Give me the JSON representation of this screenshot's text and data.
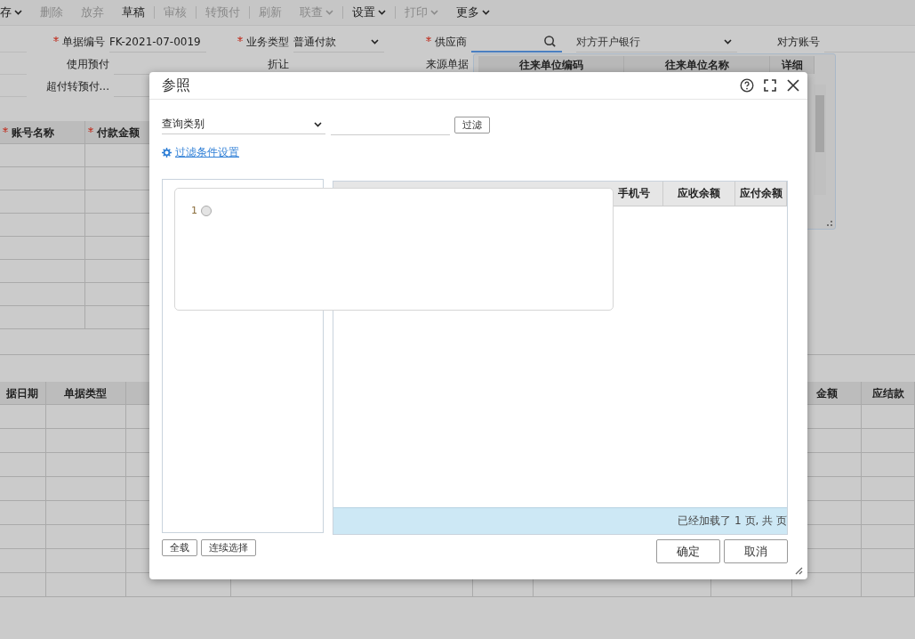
{
  "toolbar": [
    {
      "label": "存",
      "dropdown": true,
      "disabled": false,
      "separator": false
    },
    {
      "label": "删除",
      "dropdown": false,
      "disabled": true,
      "separator": false
    },
    {
      "label": "放弃",
      "dropdown": false,
      "disabled": true,
      "separator": false
    },
    {
      "label": "草稿",
      "dropdown": false,
      "disabled": false,
      "separator": false
    },
    {
      "label": "审核",
      "dropdown": false,
      "disabled": true,
      "separator": true
    },
    {
      "label": "转预付",
      "dropdown": false,
      "disabled": true,
      "separator": true
    },
    {
      "label": "刷新",
      "dropdown": false,
      "disabled": true,
      "separator": true
    },
    {
      "label": "联查",
      "dropdown": true,
      "disabled": true,
      "separator": false
    },
    {
      "label": "设置",
      "dropdown": true,
      "disabled": false,
      "separator": true
    },
    {
      "label": "打印",
      "dropdown": true,
      "disabled": true,
      "separator": true
    },
    {
      "label": "更多",
      "dropdown": true,
      "disabled": false,
      "separator": false
    }
  ],
  "form": {
    "rows": [
      [
        {
          "label": "单据编号",
          "required": true,
          "kind": "text",
          "value": "FK-2021-07-0019"
        },
        {
          "label": "业务类型",
          "required": true,
          "kind": "select",
          "value": "普通付款"
        },
        {
          "label": "供应商",
          "required": true,
          "kind": "search"
        },
        {
          "kind": "select",
          "placeholder": "对方开户银行"
        },
        {
          "label": "对方账号",
          "required": false,
          "kind": "text"
        }
      ],
      [
        {
          "label": "使用预付",
          "required": false,
          "kind": "text"
        },
        {
          "label": "折让",
          "required": false,
          "kind": "text"
        },
        {
          "label": "来源单据",
          "required": false,
          "kind": "text"
        }
      ],
      [
        {
          "label": "超付转预付...",
          "required": false,
          "kind": "text"
        }
      ]
    ]
  },
  "supplier_dropdown": {
    "columns": [
      "往来单位编码",
      "往来单位名称",
      "详细"
    ]
  },
  "detail_grid": {
    "columns": [
      {
        "label": "账号名称",
        "required": true
      },
      {
        "label": "付款金额",
        "required": true
      }
    ]
  },
  "bottom_grid": {
    "columns": [
      {
        "label": "据日期"
      },
      {
        "label": "单据类型"
      },
      {},
      {},
      {},
      {},
      {},
      {
        "label": "金额"
      },
      {
        "label": "应结款"
      }
    ]
  },
  "dialog": {
    "title": "参照",
    "query_select": {
      "value": "查询类别"
    },
    "filter_button": "过滤",
    "filter_link": "过滤条件设置",
    "popup_items": [
      {
        "label": "1",
        "selected": false
      }
    ],
    "grid": {
      "columns": [
        "手机号",
        "应收余额",
        "应付余额"
      ],
      "status": "已经加载了 1 页, 共 页"
    },
    "left_buttons": [
      "全载",
      "连续选择"
    ],
    "buttons": [
      "确定",
      "取消"
    ]
  }
}
